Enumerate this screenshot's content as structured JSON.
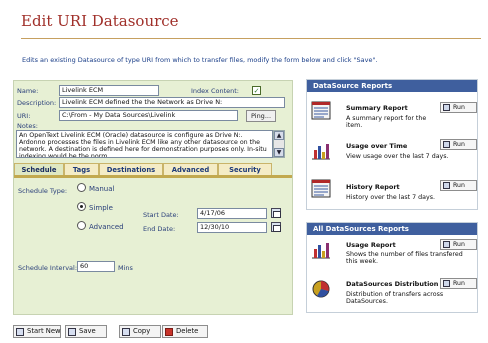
{
  "page": {
    "title": "Edit URI Datasource",
    "description": "Edits an existing Datasource of type URI from which to transfer files, modify the form below and click \"Save\"."
  },
  "form": {
    "name_label": "Name:",
    "name_value": "Livelink ECM",
    "index_label": "Index Content:",
    "index_checked": true,
    "description_label": "Description:",
    "description_value": "Livelink ECM defined the the Network as Drive N:",
    "uri_label": "URI:",
    "uri_value": "C:\\From - My Data Sources\\Livelink",
    "ping_label": "Ping...",
    "notes_label": "Notes:",
    "notes_value": "An OpenText Livelink ECM (Oracle) datasource is configure as Drive N:. Ardonno processes the files in Livelink ECM like any other datasource on the network. A destination is defined here for demonstration purposes only. In-situ indexing would be the norm."
  },
  "tabs": [
    "Schedule",
    "Tags",
    "Destinations",
    "Advanced",
    "Security"
  ],
  "schedule": {
    "type_label": "Schedule Type:",
    "options": [
      "Manual",
      "Simple",
      "Advanced"
    ],
    "selected": "Simple",
    "start_label": "Start Date:",
    "start_value": "4/17/06",
    "end_label": "End Date:",
    "end_value": "12/30/10",
    "interval_label": "Schedule Interval:",
    "interval_value": "60",
    "interval_unit": "Mins"
  },
  "actions": {
    "start_new": "Start New",
    "save": "Save",
    "copy": "Copy",
    "delete": "Delete"
  },
  "datasource_reports": {
    "heading": "DataSource Reports",
    "run_label": "Run",
    "items": [
      {
        "title": "Summary Report",
        "subtitle": "A summary report for the item."
      },
      {
        "title": "Usage over Time",
        "subtitle": "View usage over the last 7 days."
      },
      {
        "title": "History Report",
        "subtitle": "History over the last 7 days."
      }
    ]
  },
  "all_reports": {
    "heading": "All DataSources Reports",
    "run_label": "Run",
    "items": [
      {
        "title": "Usage Report",
        "subtitle": "Shows the number of files transfered this week."
      },
      {
        "title": "DataSources Distribution",
        "subtitle": "Distribution of transfers across DataSources."
      }
    ]
  },
  "colors": {
    "title": "#a0302a",
    "panel_bg": "#e7f0d4",
    "report_header": "#3f5f9e",
    "tab_bar": "#c2a94f"
  }
}
